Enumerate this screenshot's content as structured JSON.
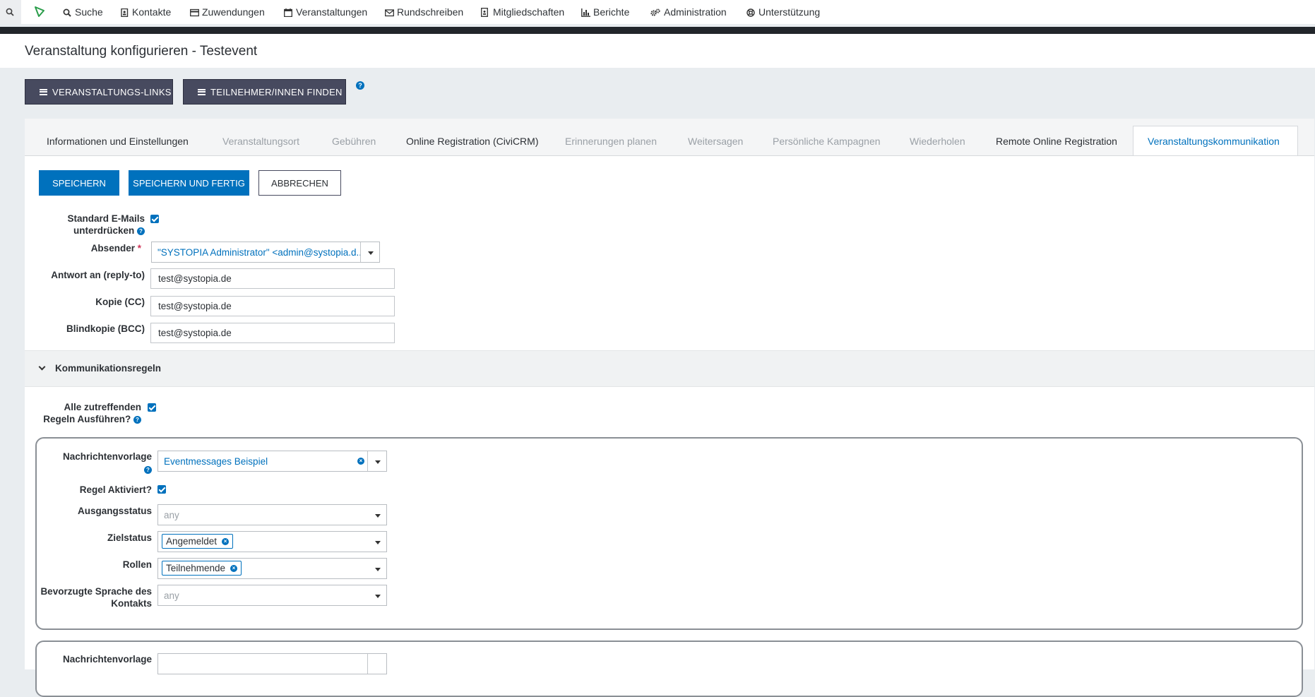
{
  "nav": {
    "items": [
      {
        "label": "Suche",
        "icon": "search-icon"
      },
      {
        "label": "Kontakte",
        "icon": "address-book-icon"
      },
      {
        "label": "Zuwendungen",
        "icon": "credit-card-icon"
      },
      {
        "label": "Veranstaltungen",
        "icon": "calendar-icon"
      },
      {
        "label": "Rundschreiben",
        "icon": "envelope-icon"
      },
      {
        "label": "Mitgliedschaften",
        "icon": "id-badge-icon"
      },
      {
        "label": "Berichte",
        "icon": "bar-chart-icon"
      },
      {
        "label": "Administration",
        "icon": "gears-icon"
      },
      {
        "label": "Unterstützung",
        "icon": "life-ring-icon"
      }
    ]
  },
  "page": {
    "title": "Veranstaltung konfigurieren - Testevent"
  },
  "actions": {
    "links_label": "VERANSTALTUNGS-LINKS",
    "find_label": "TEILNEHMER/INNEN FINDEN"
  },
  "tabs": [
    {
      "label": "Informationen und Einstellungen",
      "state": "dark"
    },
    {
      "label": "Veranstaltungsort",
      "state": "muted"
    },
    {
      "label": "Gebühren",
      "state": "muted"
    },
    {
      "label": "Online Registration (CiviCRM)",
      "state": "dark"
    },
    {
      "label": "Erinnerungen planen",
      "state": "muted"
    },
    {
      "label": "Weitersagen",
      "state": "muted"
    },
    {
      "label": "Persönliche Kampagnen",
      "state": "muted"
    },
    {
      "label": "Wiederholen",
      "state": "muted"
    },
    {
      "label": "Remote Online Registration",
      "state": "dark"
    },
    {
      "label": "Veranstaltungskommunikation",
      "state": "active"
    }
  ],
  "buttons": {
    "save": "SPEICHERN",
    "save_done": "SPEICHERN UND FERTIG",
    "cancel": "ABBRECHEN"
  },
  "form": {
    "suppress_label_1": "Standard E-Mails",
    "suppress_label_2": "unterdrücken",
    "suppress_checked": true,
    "sender_label": "Absender",
    "sender_required": "*",
    "sender_value": "\"SYSTOPIA Administrator\" <admin@systopia.d...",
    "replyto_label": "Antwort an (reply-to)",
    "replyto_value": "test@systopia.de",
    "cc_label": "Kopie (CC)",
    "cc_value": "test@systopia.de",
    "bcc_label": "Blindkopie (BCC)",
    "bcc_value": "test@systopia.de"
  },
  "rules_section": {
    "title": "Kommunikationsregeln",
    "run_all_label_1": "Alle zutreffenden",
    "run_all_label_2": "Regeln Ausführen?",
    "run_all_checked": true
  },
  "rule1": {
    "template_label": "Nachrichtenvorlage",
    "template_value": "Eventmessages Beispiel",
    "enabled_label": "Regel Aktiviert?",
    "enabled_checked": true,
    "from_status_label": "Ausgangsstatus",
    "from_status_value": "any",
    "to_status_label": "Zielstatus",
    "to_status_tag": "Angemeldet",
    "roles_label": "Rollen",
    "roles_tag": "Teilnehmende",
    "language_label_1": "Bevorzugte Sprache des",
    "language_label_2": "Kontakts",
    "language_value": "any"
  },
  "rule2": {
    "template_label": "Nachrichtenvorlage"
  },
  "colors": {
    "accent": "#0071bd",
    "dark_button": "#474a5f",
    "required": "#cf3458"
  }
}
